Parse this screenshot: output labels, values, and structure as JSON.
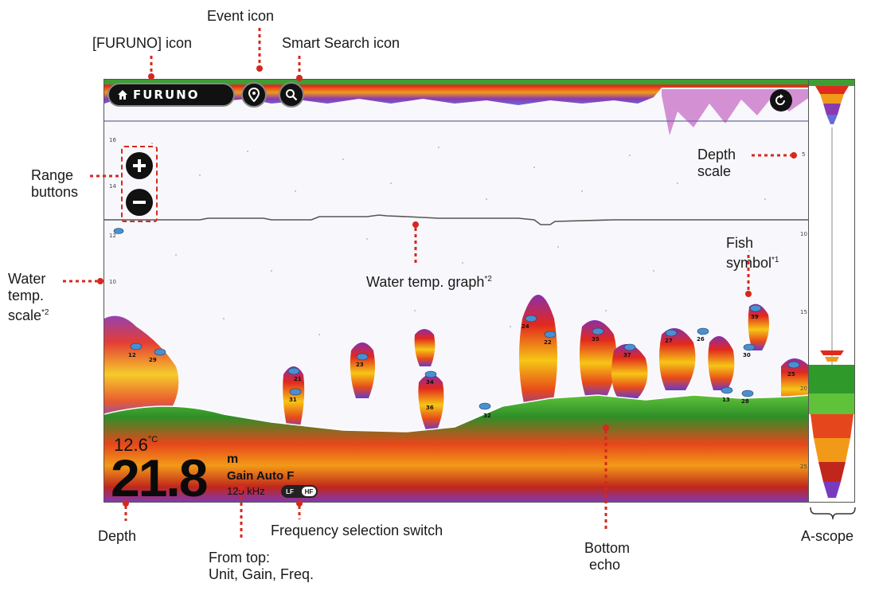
{
  "screen": {
    "furuno_label": "FURUNO",
    "readout": {
      "water_temp": "12.6",
      "water_temp_unit": "°C",
      "depth": "21.8",
      "depth_unit": "m",
      "gain": "Gain Auto F",
      "frequency": "125 kHz",
      "freq_switch": {
        "lf": "LF",
        "hf": "HF",
        "selected": "HF"
      }
    },
    "depth_scale_ticks": [
      "5",
      "10",
      "15",
      "20",
      "25"
    ],
    "temp_scale_ticks": [
      "16",
      "14",
      "12",
      "10"
    ],
    "fish_labels": [
      "23",
      "32",
      "12",
      "29",
      "34",
      "36",
      "31",
      "24",
      "22",
      "35",
      "39",
      "37",
      "27",
      "26",
      "13",
      "30",
      "28",
      "25",
      "21"
    ]
  },
  "annotations": {
    "furuno_icon": "[FURUNO] icon",
    "event_icon": "Event icon",
    "smart_search_icon": "Smart Search icon",
    "range_buttons_1": "Range",
    "range_buttons_2": "buttons",
    "depth_scale_1": "Depth",
    "depth_scale_2": "scale",
    "water_temp_graph": "Water temp. graph",
    "water_temp_graph_sup": "*2",
    "fish_symbol_1": "Fish",
    "fish_symbol_2": "symbol",
    "fish_symbol_sup": "*1",
    "water_temp_scale_1": "Water",
    "water_temp_scale_2": "temp.",
    "water_temp_scale_3": "scale",
    "water_temp_scale_sup": "*2",
    "depth": "Depth",
    "from_top_1": "From top:",
    "from_top_2": "Unit, Gain, Freq.",
    "freq_switch": "Frequency selection switch",
    "bottom_echo_1": "Bottom",
    "bottom_echo_2": "echo",
    "ascope": "A-scope"
  },
  "colors": {
    "annotation_red": "#d6281e",
    "bottom_green": "#2f9a2a",
    "echo_red": "#d8231c",
    "echo_yellow": "#f4c313",
    "echo_purple": "#7a2fa0"
  }
}
